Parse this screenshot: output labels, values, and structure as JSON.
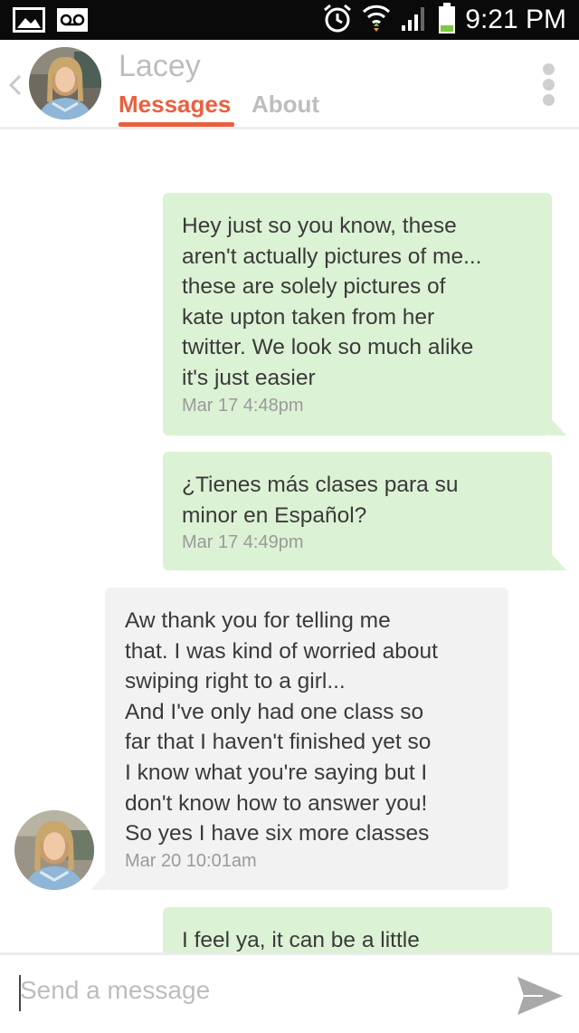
{
  "status_bar": {
    "time": "9:21 PM",
    "icons": [
      "picture-icon",
      "voicemail-icon",
      "alarm-icon",
      "wifi-icon",
      "signal-icon",
      "battery-icon"
    ]
  },
  "header": {
    "contact_name": "Lacey",
    "tabs": [
      {
        "label": "Messages",
        "active": true
      },
      {
        "label": "About",
        "active": false
      }
    ],
    "accent_color": "#e8613f"
  },
  "messages": [
    {
      "direction": "outgoing",
      "text": "Hey just so you know, these\naren't actually pictures of me...\nthese are solely pictures of\nkate upton taken from her\ntwitter. We look so much alike\nit's just easier",
      "time": "Mar 17  4:48pm"
    },
    {
      "direction": "outgoing",
      "text": "¿Tienes más clases para su\nminor en Español?",
      "time": "Mar 17  4:49pm"
    },
    {
      "direction": "incoming",
      "text": "Aw thank you for telling me\nthat. I was kind of worried about\nswiping right to a girl...\nAnd I've only had one class so\nfar that I haven't finished yet so\nI know what you're saying but I\ndon't know how to answer you!\nSo yes I have six more classes",
      "time": "Mar 20  10:01am"
    },
    {
      "direction": "outgoing",
      "text": "I feel ya, it can be a little",
      "time": ""
    }
  ],
  "composer": {
    "placeholder": "Send a message"
  },
  "colors": {
    "outgoing_bubble": "#dcf2d4",
    "incoming_bubble": "#f2f2f2"
  }
}
